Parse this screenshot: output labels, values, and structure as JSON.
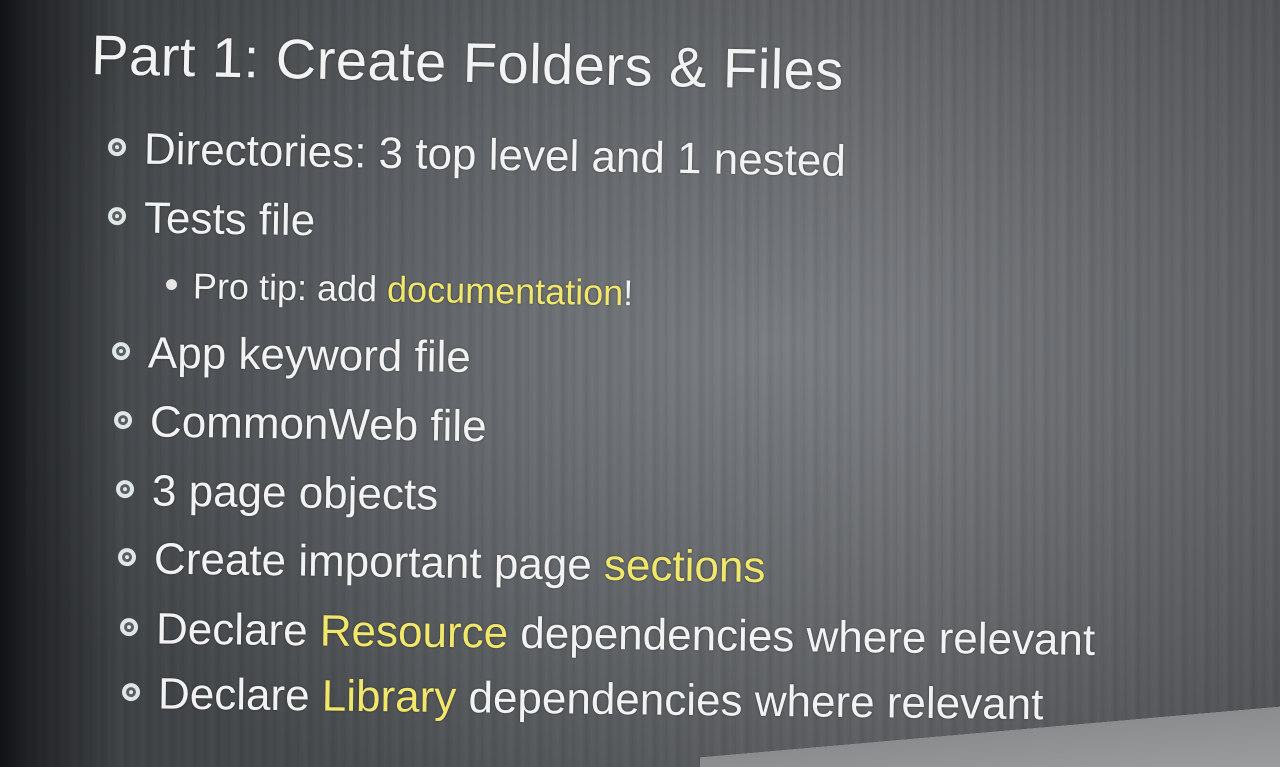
{
  "slide": {
    "title": "Part 1: Create Folders & Files",
    "items": [
      {
        "level": 1,
        "parts": [
          "Directories: 3 top level and 1 nested"
        ]
      },
      {
        "level": 1,
        "parts": [
          "Tests file"
        ]
      },
      {
        "level": 2,
        "parts": [
          "Pro tip: add ",
          "documentation",
          "!"
        ]
      },
      {
        "level": 1,
        "parts": [
          "App keyword file"
        ]
      },
      {
        "level": 1,
        "parts": [
          "CommonWeb file"
        ]
      },
      {
        "level": 1,
        "parts": [
          "3 page objects"
        ]
      },
      {
        "level": 1,
        "parts": [
          "Create important page ",
          "sections"
        ]
      },
      {
        "level": 1,
        "parts": [
          "Declare ",
          "Resource",
          " dependencies where relevant"
        ]
      },
      {
        "level": 1,
        "parts": [
          "Declare ",
          "Library",
          " dependencies where relevant"
        ]
      }
    ]
  },
  "colors": {
    "text": "#f2f2f2",
    "highlight": "#f1e76a",
    "background": "#6b6f73"
  },
  "icons": {
    "level1_bullet": "circle-target-bullet-icon",
    "level2_bullet": "dot-bullet-icon"
  }
}
